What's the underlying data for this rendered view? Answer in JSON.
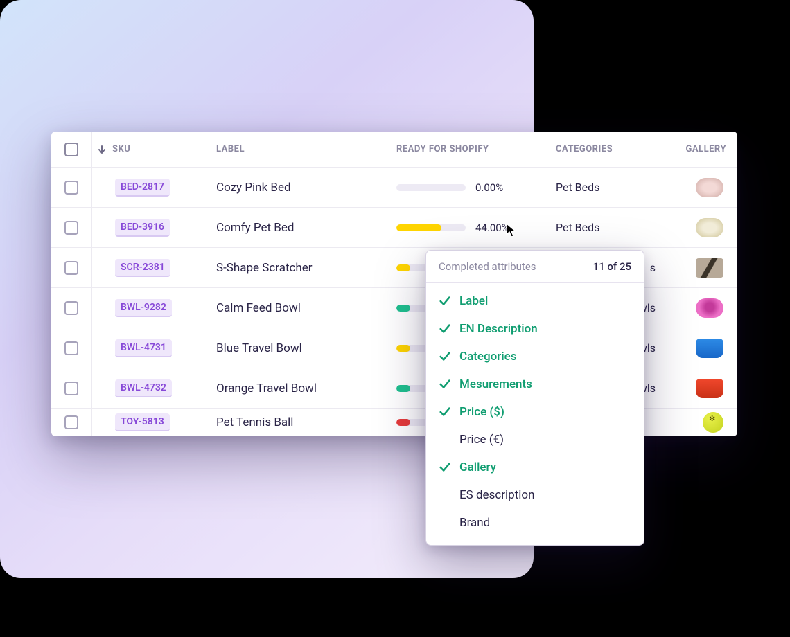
{
  "table": {
    "headers": {
      "sku": "SKU",
      "label": "LABEL",
      "ready": "READY FOR SHOPIFY",
      "categories": "CATEGORIES",
      "gallery": "GALLERY"
    },
    "rows": [
      {
        "sku": "BED-2817",
        "label": "Cozy Pink Bed",
        "pct": "0.00%",
        "fill_pct": 0,
        "fill_color": "",
        "categories": "Pet Beds",
        "thumb": "pinkbed"
      },
      {
        "sku": "BED-3916",
        "label": "Comfy Pet Bed",
        "pct": "44.00%",
        "fill_pct": 65,
        "fill_color": "fill-yellow",
        "categories": "Pet Beds",
        "thumb": "cream"
      },
      {
        "sku": "SCR-2381",
        "label": "S-Shape Scratcher",
        "pct": "",
        "fill_pct": 20,
        "fill_color": "fill-yellow",
        "categories": "",
        "categories_suffix": "s",
        "thumb": "scratch"
      },
      {
        "sku": "BWL-9282",
        "label": "Calm Feed Bowl",
        "pct": "",
        "fill_pct": 20,
        "fill_color": "fill-green",
        "categories": "",
        "categories_suffix": "wls",
        "thumb": "pinkbowl"
      },
      {
        "sku": "BWL-4731",
        "label": "Blue Travel Bowl",
        "pct": "",
        "fill_pct": 20,
        "fill_color": "fill-yellow",
        "categories": "",
        "categories_suffix": "wls",
        "thumb": "bluebowl"
      },
      {
        "sku": "BWL-4732",
        "label": "Orange Travel Bowl",
        "pct": "",
        "fill_pct": 20,
        "fill_color": "fill-green",
        "categories": "",
        "categories_suffix": "wls",
        "thumb": "orangebowl"
      },
      {
        "sku": "TOY-5813",
        "label": "Pet Tennis Ball",
        "pct": "",
        "fill_pct": 20,
        "fill_color": "fill-red",
        "categories": "",
        "categories_suffix": "",
        "thumb": "ball"
      }
    ]
  },
  "popover": {
    "title": "Completed attributes",
    "count": "11 of 25",
    "attributes": [
      {
        "label": "Label",
        "done": true
      },
      {
        "label": "EN Description",
        "done": true
      },
      {
        "label": "Categories",
        "done": true
      },
      {
        "label": "Mesurements",
        "done": true
      },
      {
        "label": "Price ($)",
        "done": true
      },
      {
        "label": "Price (€)",
        "done": false
      },
      {
        "label": "Gallery",
        "done": true
      },
      {
        "label": "ES description",
        "done": false
      },
      {
        "label": "Brand",
        "done": false
      }
    ]
  }
}
